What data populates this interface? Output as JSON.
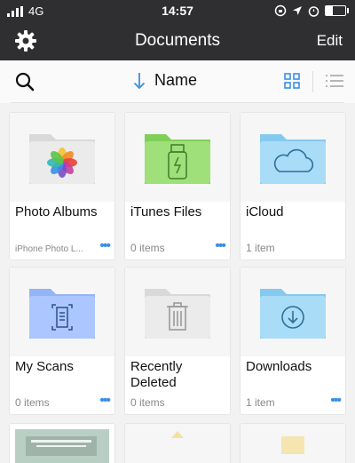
{
  "status": {
    "carrier": "4G",
    "time": "14:57"
  },
  "nav": {
    "title": "Documents",
    "edit": "Edit"
  },
  "toolbar": {
    "sort_label": "Name"
  },
  "tiles": [
    {
      "name": "Photo Albums",
      "meta": "iPhone Photo L...",
      "folder_color": "#ebebeb"
    },
    {
      "name": "iTunes Files",
      "meta": "0 items",
      "folder_color": "#9fe07a"
    },
    {
      "name": "iCloud",
      "meta": "1 item",
      "folder_color": "#a9dcf7"
    },
    {
      "name": "My Scans",
      "meta": "0 items",
      "folder_color": "#acc7ff"
    },
    {
      "name": "Recently\nDeleted",
      "meta": "0 items",
      "folder_color": "#ebebeb"
    },
    {
      "name": "Downloads",
      "meta": "1 item",
      "folder_color": "#a9dcf7"
    }
  ]
}
